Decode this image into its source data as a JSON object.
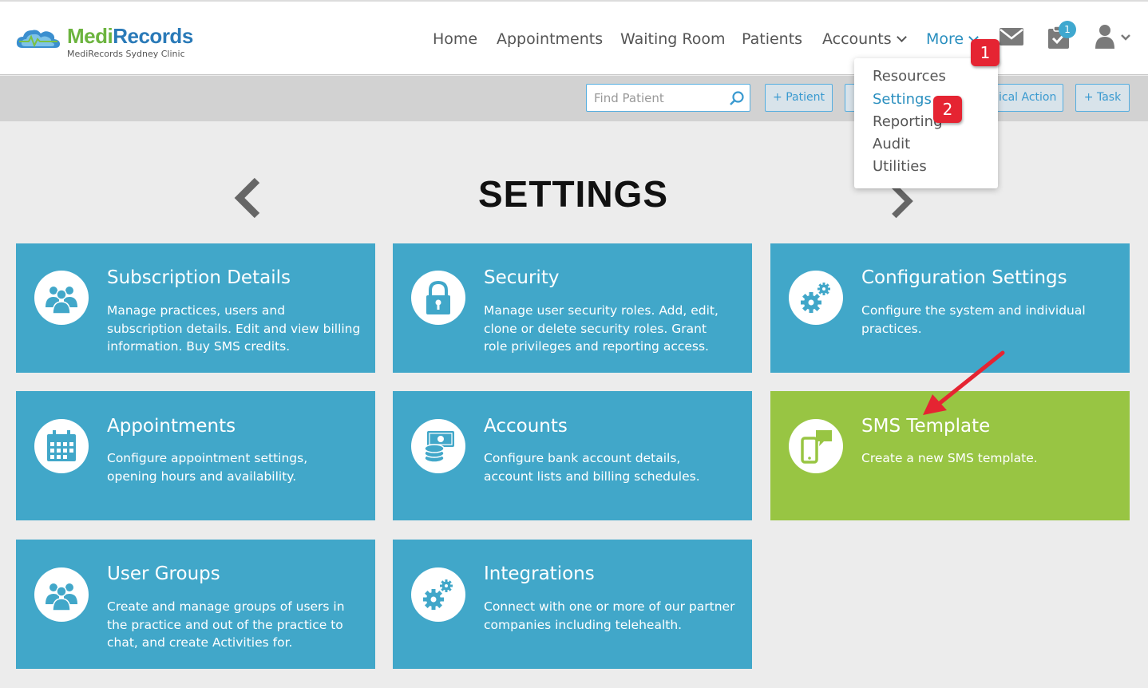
{
  "app": {
    "brand_medi": "Medi",
    "brand_records": "Records",
    "clinic": "MediRecords Sydney Clinic"
  },
  "nav": {
    "items": [
      {
        "label": "Home"
      },
      {
        "label": "Appointments"
      },
      {
        "label": "Waiting Room"
      },
      {
        "label": "Patients"
      },
      {
        "label": "Accounts"
      },
      {
        "label": "More"
      }
    ],
    "tasks_badge": "1",
    "icons": [
      "mail-icon",
      "tasks-icon",
      "user-icon"
    ]
  },
  "more_menu": {
    "items": [
      {
        "label": "Resources"
      },
      {
        "label": "Settings"
      },
      {
        "label": "Reporting"
      },
      {
        "label": "Audit"
      },
      {
        "label": "Utilities"
      }
    ],
    "selected": "Settings"
  },
  "callouts": [
    "1",
    "2"
  ],
  "toolbar": {
    "search_placeholder": "Find Patient",
    "add_patient": "+ Patient",
    "clinical_action": "ical Action",
    "add_task": "+ Task"
  },
  "page": {
    "title": "SETTINGS"
  },
  "tiles": [
    {
      "title": "Subscription Details",
      "desc": "Manage practices, users and subscription details. Edit and view billing information. Buy SMS credits.",
      "icon": "users-icon"
    },
    {
      "title": "Security",
      "desc": "Manage user security roles. Add, edit, clone or delete security roles. Grant role privileges and reporting access.",
      "icon": "lock-icon"
    },
    {
      "title": "Configuration Settings",
      "desc": "Configure the system and individual practices.",
      "icon": "gears-icon"
    },
    {
      "title": "Appointments",
      "desc": "Configure appointment settings, opening hours and availability.",
      "icon": "calendar-icon"
    },
    {
      "title": "Accounts",
      "desc": "Configure bank account details, account lists and billing schedules.",
      "icon": "money-icon"
    },
    {
      "title": "SMS Template",
      "desc": "Create a new SMS template.",
      "icon": "phone-message-icon",
      "highlighted": true
    },
    {
      "title": "User Groups",
      "desc": "Create and manage groups of users in the practice and out of the practice to chat, and create Activities for.",
      "icon": "users-icon"
    },
    {
      "title": "Integrations",
      "desc": "Connect with one or more of our partner companies including telehealth.",
      "icon": "gears-icon"
    }
  ],
  "colors": {
    "tile_blue": "#41a7c9",
    "tile_green": "#98c543",
    "accent": "#2a8fbf",
    "callout_red": "#e52432"
  }
}
